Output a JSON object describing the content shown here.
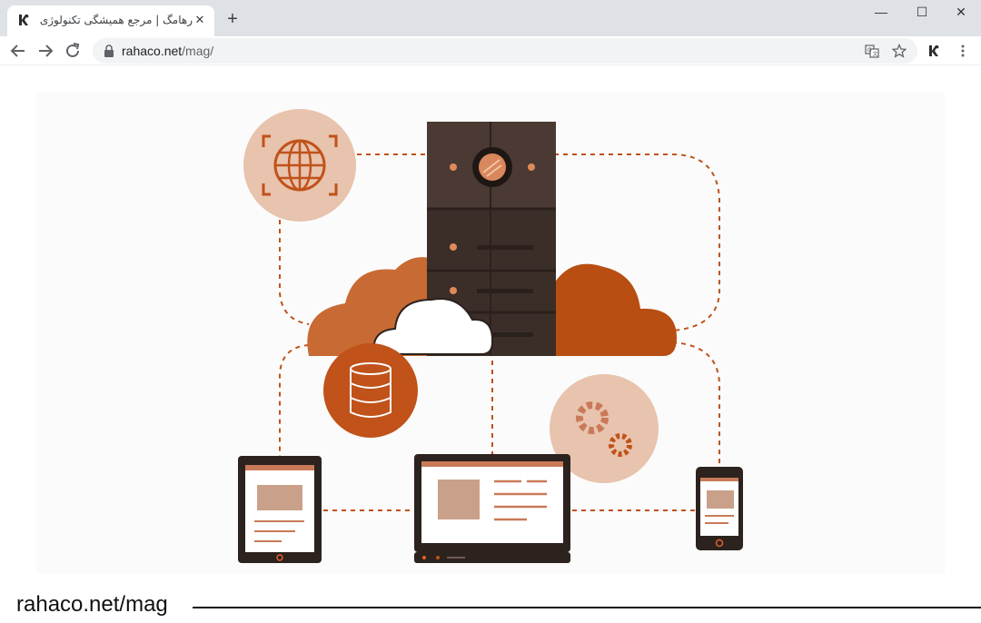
{
  "browser": {
    "tab": {
      "title": "رهامگ | مرجع همیشگی تکنولوژی |",
      "favicon": "rahaco-logo-icon",
      "close_label": "✕"
    },
    "new_tab_label": "+",
    "window_controls": {
      "minimize": "—",
      "maximize": "☐",
      "close": "✕"
    },
    "address": {
      "host": "rahaco.net",
      "path": "/mag/"
    }
  },
  "page": {
    "footer_label": "rahaco.net/mag",
    "illustration_icons": [
      "globe-icon",
      "server-icon",
      "cloud-icon",
      "database-icon",
      "gears-icon",
      "tablet-icon",
      "laptop-icon",
      "phone-icon"
    ],
    "colors": {
      "accent": "#c0521a",
      "accent_light": "#e8c3ad",
      "dark": "#3b2e28",
      "line": "#c0521a"
    }
  }
}
